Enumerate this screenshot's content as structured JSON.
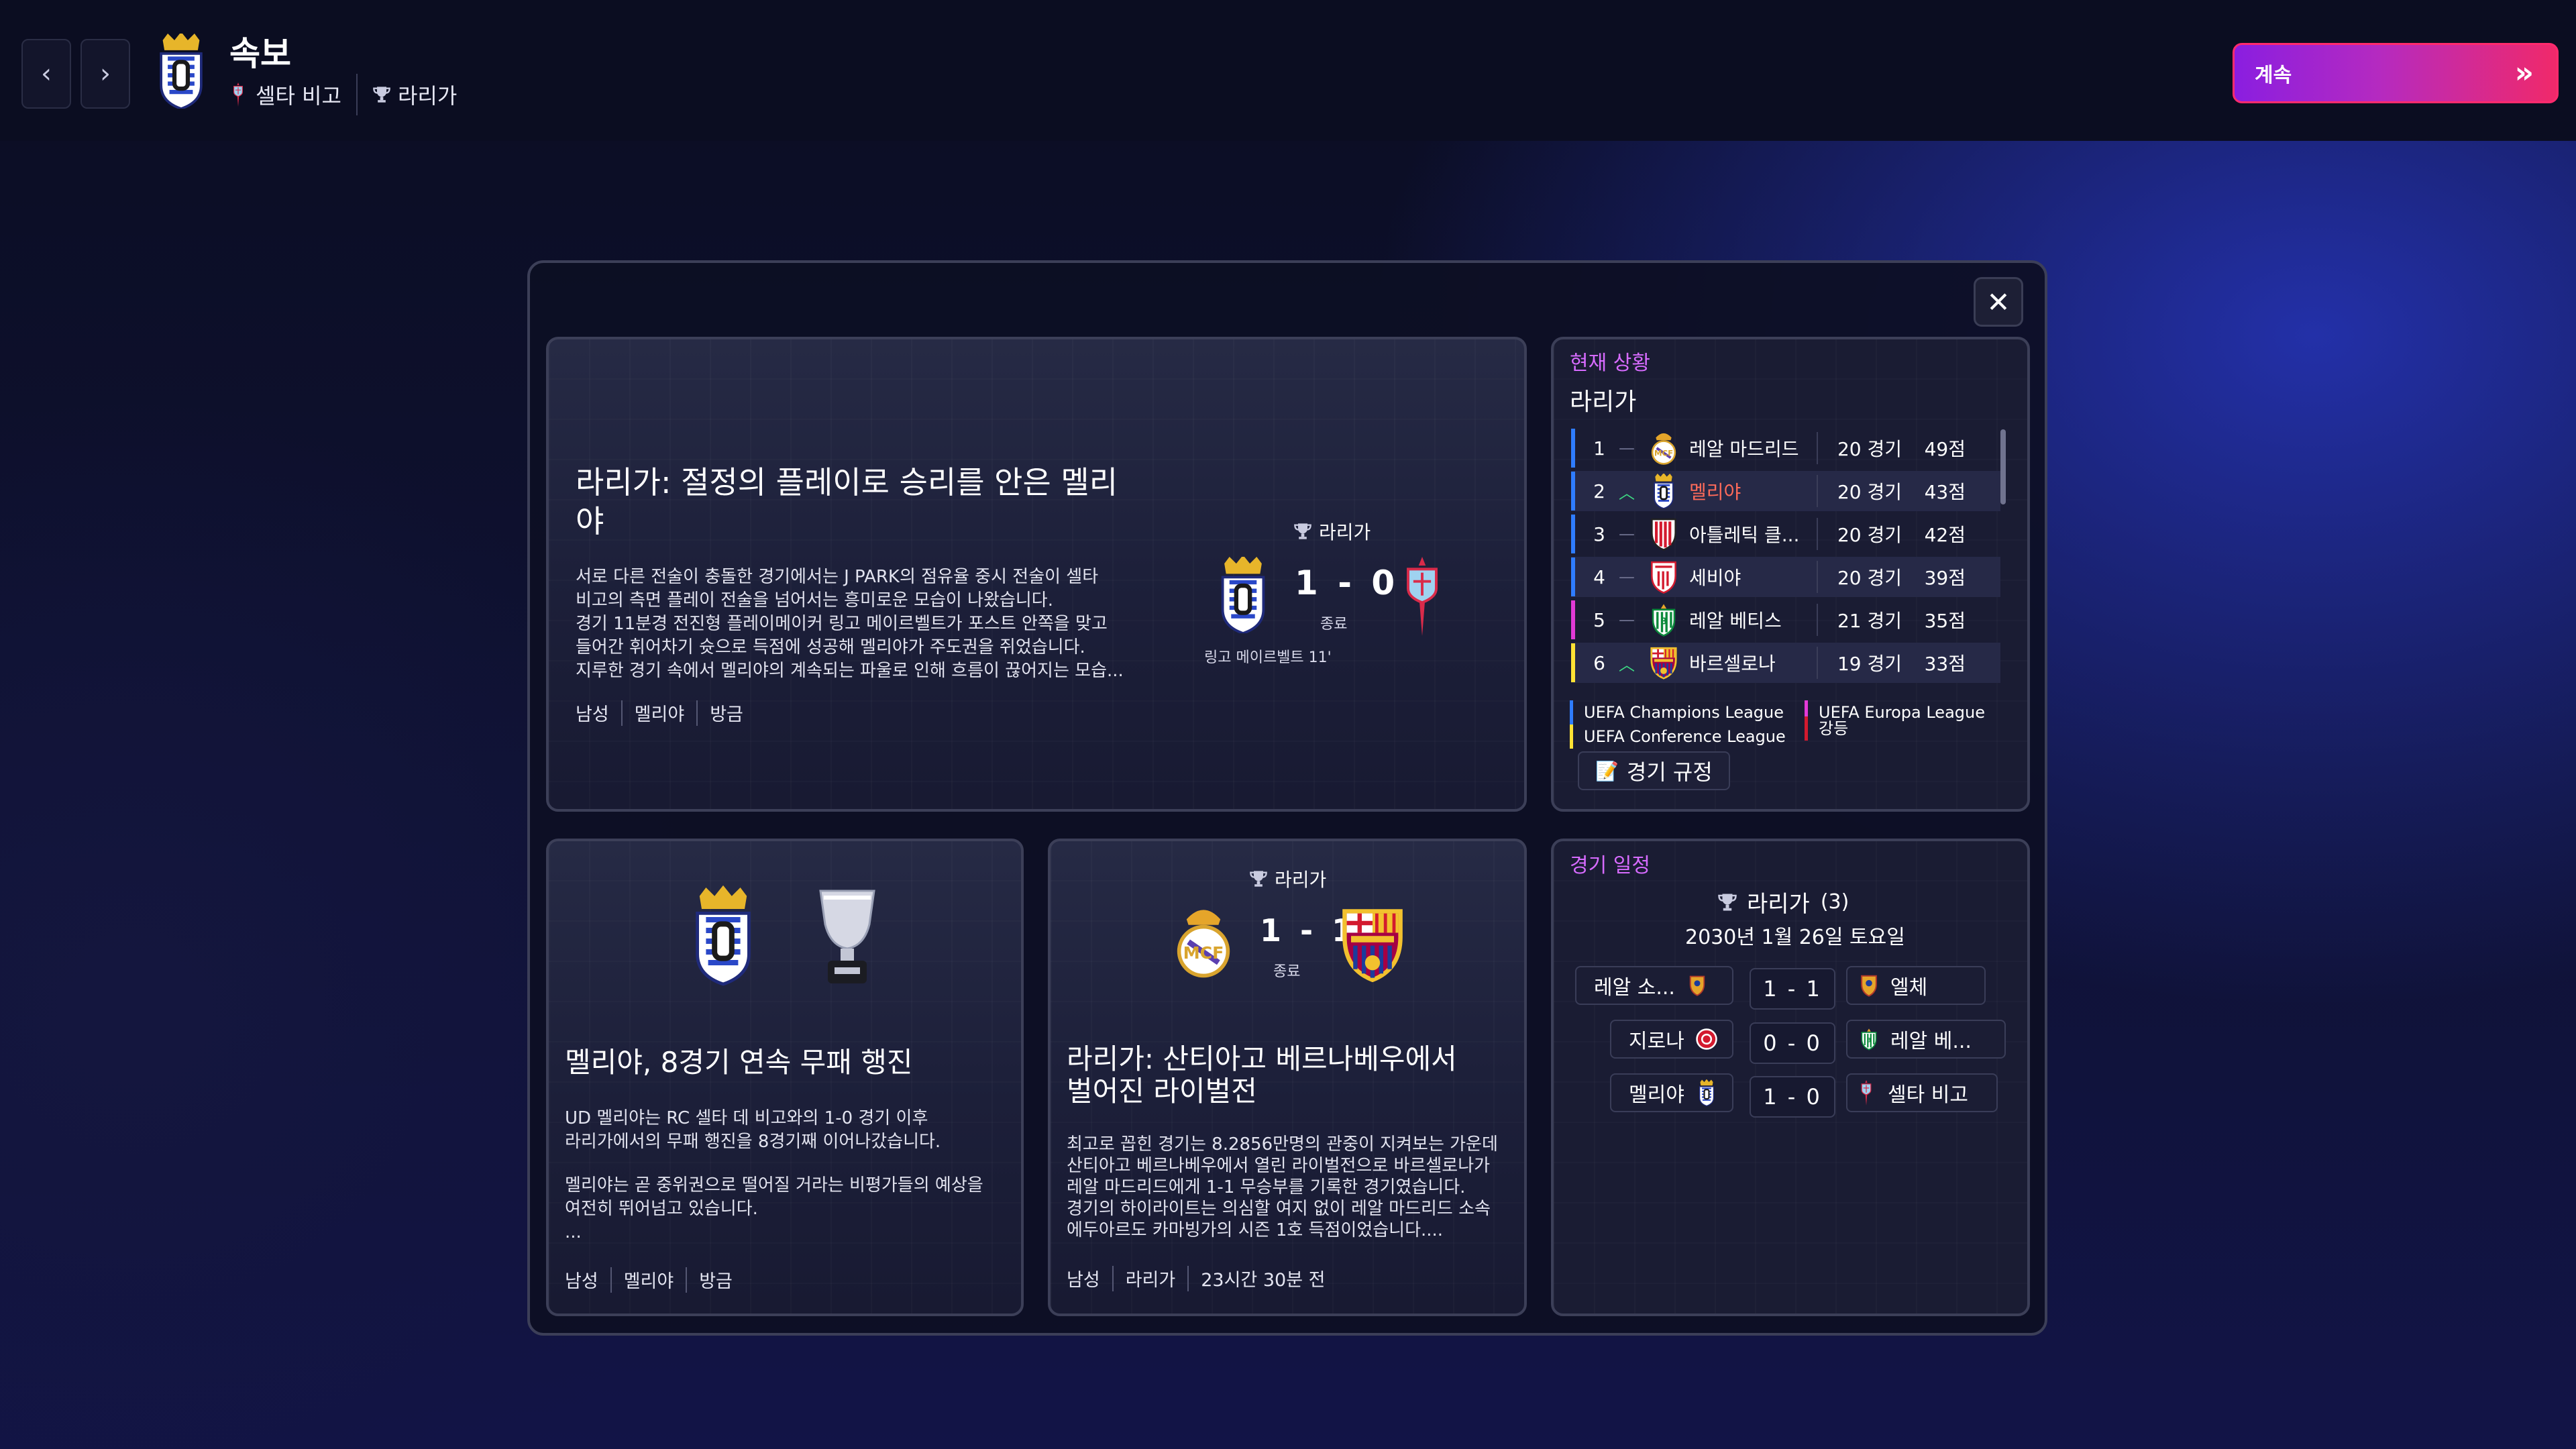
{
  "header": {
    "title": "속보",
    "opponent": "셀타 비고",
    "league": "라리가",
    "continue_label": "계속"
  },
  "feature": {
    "headline": "라리가: 절정의 플레이로 승리를 안은 멜리야",
    "body": [
      "서로 다른 전술이 충돌한 경기에서는 J PARK의 점유율 중시 전술이 셀타",
      "비고의 측면 플레이 전술을 넘어서는 흥미로운 모습이 나왔습니다.",
      "경기 11분경 전진형 플레이메이커 링고 메이르벨트가 포스트 안쪽을 맞고",
      "들어간 휘어차기 슛으로 득점에 성공해 멜리야가 주도권을 쥐었습니다.",
      "지루한 경기 속에서 멜리야의 계속되는 파울로 인해 흐름이 끊어지는 모습..."
    ],
    "tags": [
      "남성",
      "멜리야",
      "방금"
    ],
    "league": "라리가",
    "score": "1 - 0",
    "status": "종료",
    "scorer": "링고 메이르벨트 11'"
  },
  "standings": {
    "section": "현재 상황",
    "league": "라리가",
    "rows": [
      {
        "pos": "1",
        "move": "—",
        "team": "레알 마드리드",
        "games": "20 경기",
        "points": "49점",
        "bar": "#2f7cff"
      },
      {
        "pos": "2",
        "move": "︿",
        "team": "멜리야",
        "games": "20 경기",
        "points": "43점",
        "bar": "#2f7cff"
      },
      {
        "pos": "3",
        "move": "—",
        "team": "아틀레틱 클...",
        "games": "20 경기",
        "points": "42점",
        "bar": "#2f7cff"
      },
      {
        "pos": "4",
        "move": "—",
        "team": "세비야",
        "games": "20 경기",
        "points": "39점",
        "bar": "#2f7cff"
      },
      {
        "pos": "5",
        "move": "—",
        "team": "레알 베티스",
        "games": "21 경기",
        "points": "35점",
        "bar": "#e23ad6"
      },
      {
        "pos": "6",
        "move": "︿",
        "team": "바르셀로나",
        "games": "19 경기",
        "points": "33점",
        "bar": "#ffe234"
      }
    ],
    "legend": [
      "UEFA Champions League",
      "UEFA Europa League",
      "UEFA Conference League",
      "강등"
    ],
    "rules_label": "경기 규정"
  },
  "card2": {
    "headline": "멜리야, 8경기 연속 무패 행진",
    "body": [
      "UD 멜리야는 RC 셀타 데 비고와의 1-0 경기 이후",
      "라리가에서의 무패 행진을 8경기째 이어나갔습니다.",
      "멜리야는 곧 중위권으로 떨어질 거라는 비평가들의 예상을",
      "여전히 뛰어넘고 있습니다.",
      "..."
    ],
    "tags": [
      "남성",
      "멜리야",
      "방금"
    ]
  },
  "card3": {
    "league": "라리가",
    "score": "1 - 1",
    "status": "종료",
    "headline": [
      "라리가: 산티아고 베르나베우에서",
      "벌어진 라이벌전"
    ],
    "body": [
      "최고로 꼽힌 경기는 8.2856만명의 관중이 지켜보는 가운데",
      "산티아고 베르나베우에서 열린 라이벌전으로 바르셀로나가",
      "레알 마드리드에게 1-1 무승부를 기록한 경기였습니다.",
      "경기의 하이라이트는 의심할 여지 없이 레알 마드리드 소속",
      "에두아르도 카마빙가의 시즌 1호 득점이었습니다...."
    ],
    "tags": [
      "남성",
      "라리가",
      "23시간 30분 전"
    ]
  },
  "fixtures": {
    "section": "경기 일정",
    "league": "라리가",
    "round": "(3)",
    "date": "2030년 1월 26일 토요일",
    "matches": [
      {
        "home": "레알 소...",
        "score": "1 - 1",
        "away": "엘체"
      },
      {
        "home": "지로나",
        "score": "0 - 0",
        "away": "레알 베..."
      },
      {
        "home": "멜리야",
        "score": "1 - 0",
        "away": "셀타 비고"
      }
    ]
  },
  "colors": {
    "accent_pink": "#d76bff",
    "continue_gradient": [
      "#8a1ee0",
      "#f0296a"
    ],
    "highlight_team": "#ff6b5a",
    "up_arrow": "#3ddc84"
  }
}
